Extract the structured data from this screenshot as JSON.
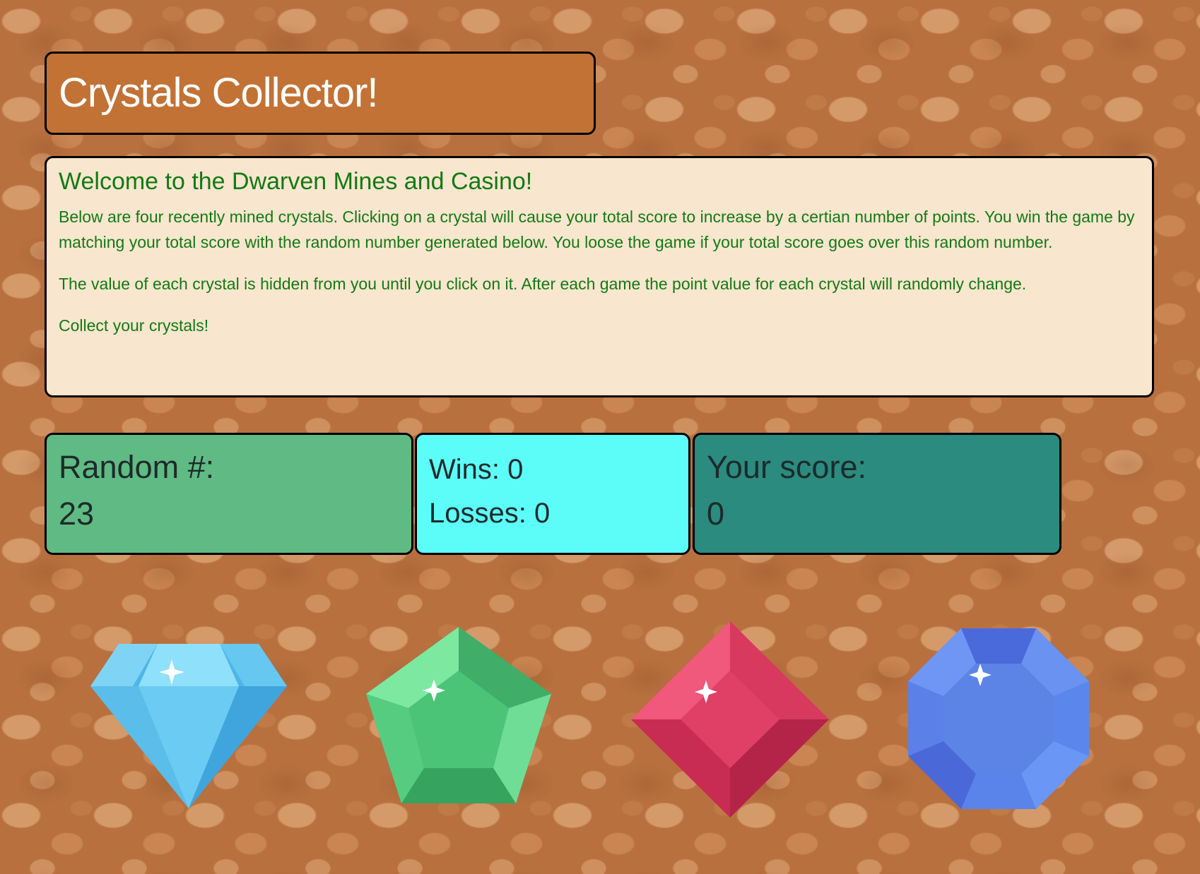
{
  "header": {
    "title": "Crystals Collector!"
  },
  "intro": {
    "heading": "Welcome to the Dwarven Mines and Casino!",
    "paragraph_1": "Below are four recently mined crystals. Clicking on a crystal will cause your total score to increase by a certian number of points. You win the game by matching your total score with the random number generated below. You loose the game if your total score goes over this random number.",
    "paragraph_2": "The value of each crystal is hidden from you until you click on it. After each game the point value for each crystal will randomly change.",
    "paragraph_3": "Collect your crystals!"
  },
  "stats": {
    "random_label": "Random #:",
    "random_value": "23",
    "wins_text": "Wins: 0",
    "losses_text": "Losses: 0",
    "score_label": "Your score:",
    "score_value": "0"
  },
  "crystals": [
    {
      "icon": "diamond-crystal-icon",
      "color": "#5ec6f0"
    },
    {
      "icon": "pentagon-crystal-icon",
      "color": "#4cc478"
    },
    {
      "icon": "ruby-crystal-icon",
      "color": "#e03f66"
    },
    {
      "icon": "octagon-crystal-icon",
      "color": "#5c84e6"
    }
  ],
  "colors": {
    "title_bg": "#c27235",
    "intro_bg": "#f8e6cf",
    "intro_text": "#137a13",
    "random_bg": "#5fbb83",
    "record_bg": "#5cfdf9",
    "score_bg": "#2a8b7e"
  }
}
